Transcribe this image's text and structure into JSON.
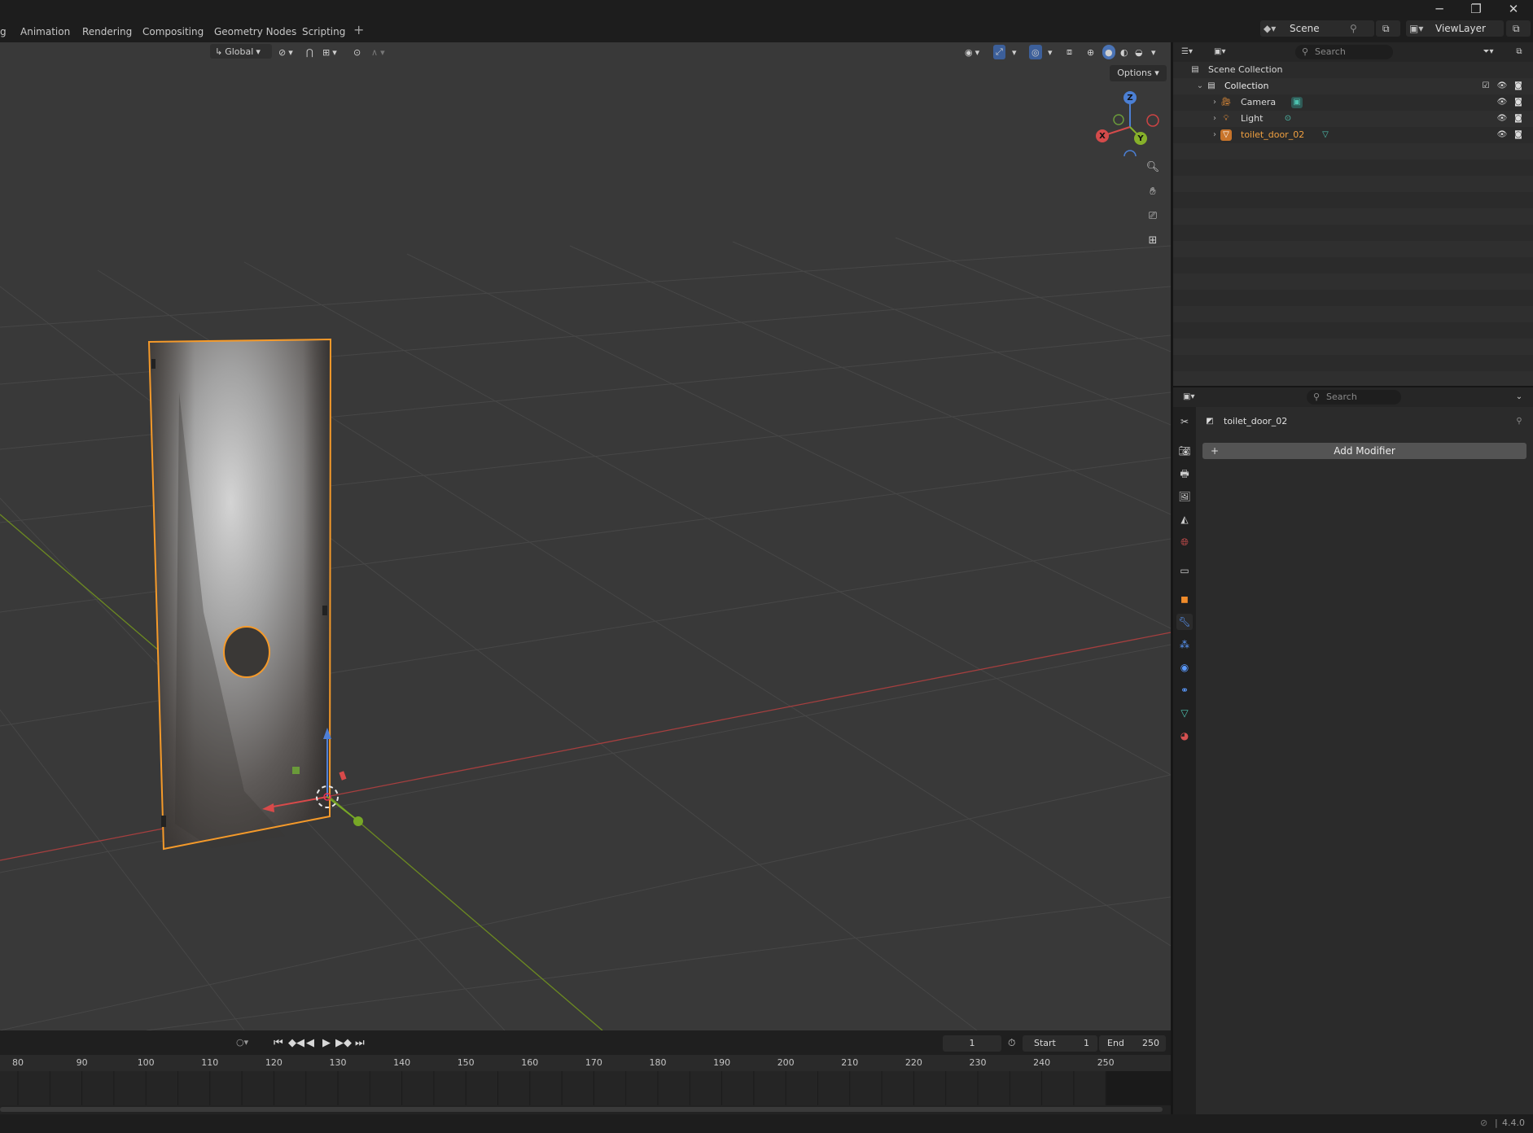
{
  "window": {
    "minimize": "─",
    "maximize": "❐",
    "close": "✕"
  },
  "workspaces": [
    "g",
    "Animation",
    "Rendering",
    "Compositing",
    "Geometry Nodes",
    "Scripting",
    "+"
  ],
  "topbar": {
    "scene": "Scene",
    "view_layer": "ViewLayer"
  },
  "viewport": {
    "orientation": "Global",
    "options_label": "Options",
    "gizmo": {
      "x": "X",
      "y": "Y",
      "z": "Z"
    },
    "nav_icons": [
      "zoom-icon",
      "hand-pan-icon",
      "camera-view-icon",
      "grid-ortho-icon"
    ],
    "object_color": "#f59a2a",
    "x_axis_color": "#c44343",
    "y_axis_color": "#7da22a"
  },
  "timeline": {
    "current_frame": "1",
    "start_label": "Start",
    "start_value": "1",
    "end_label": "End",
    "end_value": "250",
    "ticks": [
      "80",
      "90",
      "100",
      "110",
      "120",
      "130",
      "140",
      "150",
      "160",
      "170",
      "180",
      "190",
      "200",
      "210",
      "220",
      "230",
      "240",
      "250"
    ]
  },
  "outliner": {
    "search_placeholder": "Search",
    "scene_collection": "Scene Collection",
    "collection": "Collection",
    "items": [
      {
        "name": "Camera",
        "icon": "camera-icon"
      },
      {
        "name": "Light",
        "icon": "light-icon"
      },
      {
        "name": "toilet_door_02",
        "icon": "mesh-icon"
      }
    ]
  },
  "properties": {
    "search_placeholder": "Search",
    "object_name": "toilet_door_02",
    "add_modifier_label": "Add Modifier",
    "add_symbol": "+"
  },
  "status": {
    "version": "4.4.0"
  }
}
